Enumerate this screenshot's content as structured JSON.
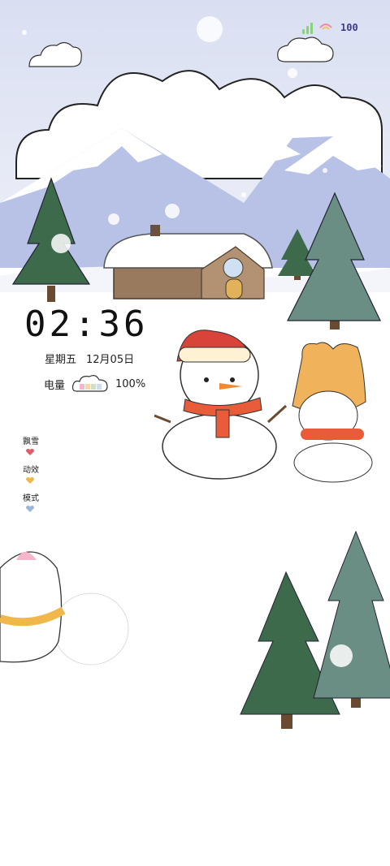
{
  "status_bar": {
    "battery_value": "100",
    "colors": {
      "signal": "#8ad27a",
      "wifi": "#f08aa0",
      "battery_text": "#3b3b88"
    }
  },
  "widget": {
    "time": "02:36",
    "weekday": "星期五",
    "date": "12月05日",
    "battery_label": "电量",
    "battery_percent": "100%",
    "menu": [
      {
        "label": "飘雪",
        "heart_color": "#e05a6a"
      },
      {
        "label": "动效",
        "heart_color": "#f0b84a"
      },
      {
        "label": "模式",
        "heart_color": "#9ab7d8"
      }
    ]
  },
  "scene": {
    "sky_color": "#dfe4f4",
    "snow_color": "#ffffff",
    "mountain_color": "#c7d0ea",
    "tree_color": "#3e6a4c",
    "house_color": "#9a7a5e"
  }
}
